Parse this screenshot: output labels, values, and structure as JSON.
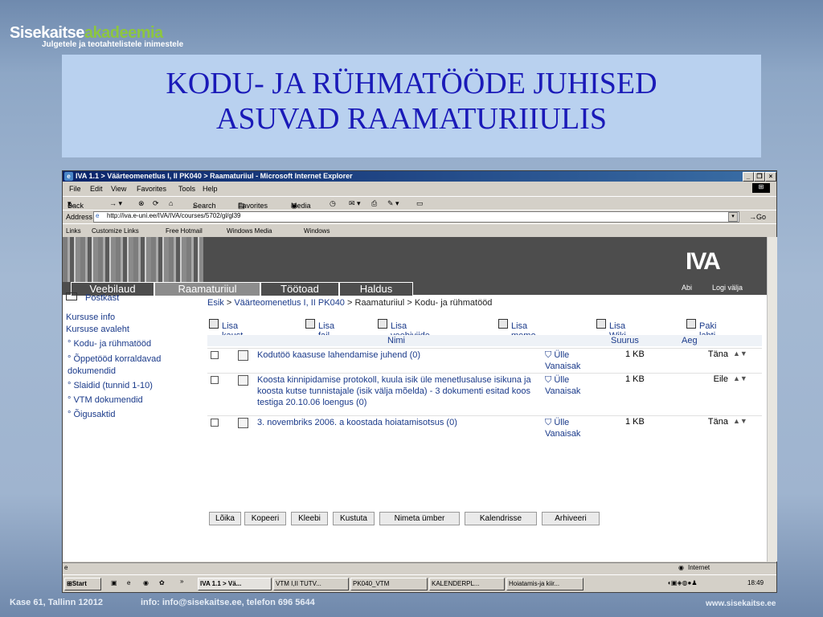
{
  "slide": {
    "brand_main": "Sisekaitse",
    "brand_accent": "akadeemia",
    "tagline": "Julgetele ja teotahtelistele inimestele",
    "title_line1": "KODU- JA RÜHMATÖÖDE JUHISED",
    "title_line2": "ASUVAD RAAMATURIIULIS",
    "footer_address": "Kase 61, Tallinn 12012",
    "footer_contact": "info: info@sisekaitse.ee, telefon 696 5644",
    "footer_url": "www.sisekaitse.ee"
  },
  "window": {
    "title": "IVA 1.1 > Väärteomenetlus I, II PK040 > Raamaturiiul - Microsoft Internet Explorer",
    "menu": [
      "File",
      "Edit",
      "View",
      "Favorites",
      "Tools",
      "Help"
    ],
    "toolbar": {
      "back": "Back",
      "search": "Search",
      "favorites": "Favorites",
      "media": "Media"
    },
    "address_label": "Address",
    "address_value": "http://iva.e-uni.ee/IVA/IVA/courses/5702/gl/gl39",
    "go_label": "Go",
    "links_label": "Links",
    "links": [
      "Customize Links",
      "Free Hotmail",
      "Windows Media",
      "Windows"
    ],
    "status_zone": "Internet"
  },
  "page": {
    "logo": "IVA",
    "top_links": [
      "Abi",
      "Logi välja"
    ],
    "tabs": [
      "Veebilaud",
      "Raamaturiiul",
      "Töötoad",
      "Haldus"
    ],
    "sidebar": {
      "postkast": "Postkast",
      "kursuse_info": "Kursuse info",
      "kursuse_avaleht": "Kursuse avaleht",
      "items": [
        "Kodu- ja rühmatööd",
        "Õppetööd korraldavad dokumendid",
        "Slaidid (tunnid 1-10)",
        "VTM dokumendid",
        "Õigusaktid"
      ]
    },
    "breadcrumb": {
      "esik": "Esik",
      "course": "Väärteomenetlus I, II PK040",
      "shelf": "Raamaturiiul",
      "current": "Kodu- ja rühmatööd",
      "sep": ">"
    },
    "actions": [
      "Lisa kaust",
      "Lisa fail",
      "Lisa veebiviide",
      "Lisa memo",
      "Lisa Wiki",
      "Paki lahti"
    ],
    "columns": {
      "name": "Nimi",
      "size": "Suurus",
      "age": "Aeg"
    },
    "rows": [
      {
        "name": "Kodutöö kaasuse lahendamise juhend",
        "count": "(0)",
        "owner": "Ülle Vanaisak",
        "size": "1 KB",
        "age": "Täna"
      },
      {
        "name": "Koosta kinnipidamise protokoll, kuula isik üle menetlusaluse isikuna ja koosta kutse tunnistajale (isik välja mõelda) - 3 dokumenti esitad koos testiga 20.10.06 loengus",
        "count": "(0)",
        "owner": "Ülle Vanaisak",
        "size": "1 KB",
        "age": "Eile"
      },
      {
        "name": "3. novembriks 2006. a koostada hoiatamisotsus",
        "count": "(0)",
        "owner": "Ülle Vanaisak",
        "size": "1 KB",
        "age": "Täna"
      }
    ],
    "buttons": [
      "Lõika",
      "Kopeeri",
      "Kleebi",
      "Kustuta",
      "Nimeta ümber",
      "Kalendrisse",
      "Arhiveeri"
    ]
  },
  "taskbar": {
    "start": "Start",
    "items": [
      "IVA 1.1 > Vä...",
      "VTM I,II TUTV...",
      "PK040_VTM",
      "KALENDERPL...",
      "Hoiatamis-ja kiir..."
    ],
    "clock": "18:49"
  }
}
